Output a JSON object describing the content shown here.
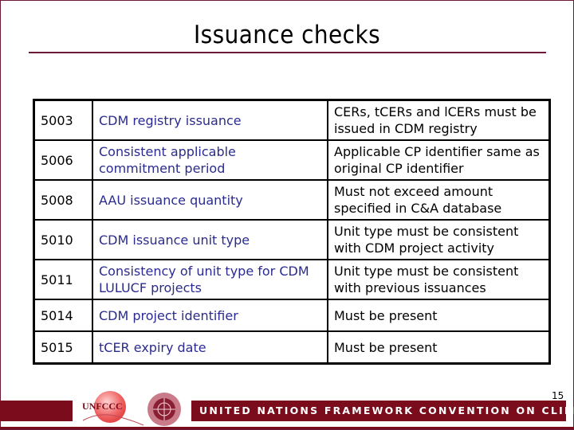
{
  "slide": {
    "title": "Issuance checks",
    "page_number": "15"
  },
  "table": {
    "rows": [
      {
        "code": "5003",
        "name": "CDM registry issuance",
        "rule": "CERs, tCERs and lCERs must be issued in CDM registry"
      },
      {
        "code": "5006",
        "name": "Consistent applicable commitment period",
        "rule": "Applicable CP identifier same as original CP identifier"
      },
      {
        "code": "5008",
        "name": "AAU issuance quantity",
        "rule": "Must not exceed amount specified in C&A database"
      },
      {
        "code": "5010",
        "name": "CDM issuance unit type",
        "rule": "Unit type must be consistent with CDM project activity"
      },
      {
        "code": "5011",
        "name": "Consistency of unit type for CDM LULUCF projects",
        "rule": "Unit type must be consistent with previous issuances"
      },
      {
        "code": "5014",
        "name": "CDM project identifier",
        "rule": "Must be present"
      },
      {
        "code": "5015",
        "name": "tCER expiry date",
        "rule": "Must be present"
      }
    ]
  },
  "footer": {
    "logo_text": "UNFCCC",
    "banner_text": "UNITED NATIONS FRAMEWORK CONVENTION ON CLIMATE CHANGE",
    "logo_icon": "unfccc-globe-logo",
    "emblem_icon": "un-emblem"
  },
  "colors": {
    "accent": "#7a0c1c",
    "frame": "#6b1a3a",
    "name_text": "#2b2b8f"
  }
}
